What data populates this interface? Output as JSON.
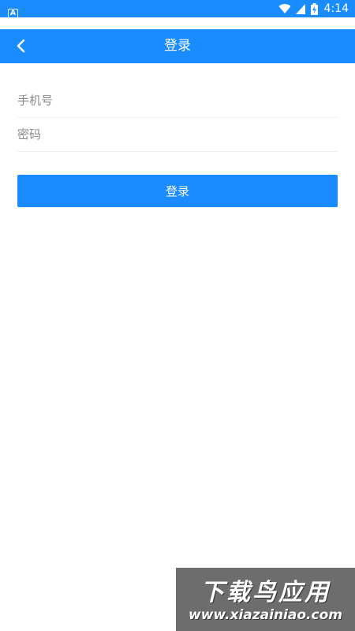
{
  "status_bar": {
    "time": "4:14",
    "left_icon": "app-notification-icon",
    "icons": [
      "wifi-icon",
      "cell-signal-icon",
      "battery-charging-icon"
    ]
  },
  "header": {
    "title": "登录",
    "back_icon": "chevron-left-icon",
    "background_color": "#1a8cff"
  },
  "form": {
    "phone_placeholder": "手机号",
    "phone_value": "",
    "password_placeholder": "密码",
    "password_value": ""
  },
  "login_button": {
    "label": "登录",
    "color": "#1a8cff"
  },
  "watermark": {
    "title": "下载鸟应用",
    "url": "www.xiazainiao.com"
  }
}
